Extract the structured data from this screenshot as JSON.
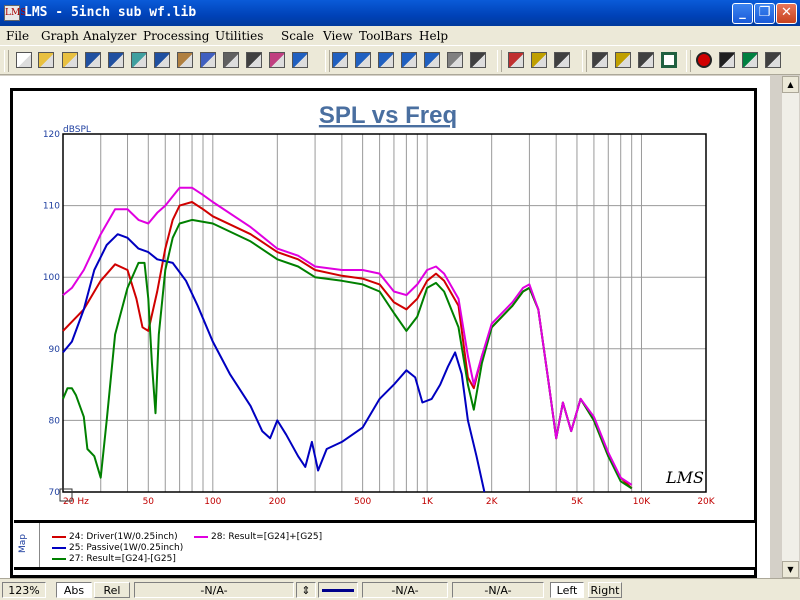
{
  "window": {
    "title": "LMS - 5inch sub wf.lib",
    "app_icon_text": "LMS"
  },
  "menu": [
    "File",
    "Graph",
    "Analyzer",
    "Processing",
    "Utilities",
    "Scale",
    "View",
    "ToolBars",
    "Help"
  ],
  "toolbar_icons": [
    "new-icon",
    "open-icon",
    "open-folder-icon",
    "save-icon",
    "save-as-icon",
    "import-icon",
    "export-icon",
    "library-icon",
    "print-preview-icon",
    "print-icon",
    "notes-icon",
    "curve-library-icon",
    "zoom-in-icon",
    "zoom-out-icon",
    "zoom-1-icon",
    "zoom-2-icon",
    "zoom-4-icon",
    "zoom-8-icon",
    "grid-icon",
    "table-icon",
    "graph-icon",
    "hardware-icon",
    "target-icon",
    "markers-icon",
    "compare-icon",
    "overlay-icon",
    "stop-icon",
    "record-icon",
    "run-icon",
    "connect-icon",
    "probe-icon"
  ],
  "chart_data": {
    "type": "line",
    "title": "SPL vs Freq",
    "ylabel": "dBSPL",
    "xscale": "log",
    "xlim": [
      20,
      20000
    ],
    "ylim": [
      70,
      120
    ],
    "grid": true,
    "xticks": [
      {
        "v": 20,
        "label": "20 Hz"
      },
      {
        "v": 50,
        "label": "50"
      },
      {
        "v": 100,
        "label": "100"
      },
      {
        "v": 200,
        "label": "200"
      },
      {
        "v": 500,
        "label": "500"
      },
      {
        "v": 1000,
        "label": "1K"
      },
      {
        "v": 2000,
        "label": "2K"
      },
      {
        "v": 5000,
        "label": "5K"
      },
      {
        "v": 10000,
        "label": "10K"
      },
      {
        "v": 20000,
        "label": "20K"
      }
    ],
    "yticks": [
      {
        "v": 70,
        "label": "70"
      },
      {
        "v": 80,
        "label": "80"
      },
      {
        "v": 90,
        "label": "90"
      },
      {
        "v": 100,
        "label": "100"
      },
      {
        "v": 110,
        "label": "110"
      },
      {
        "v": 120,
        "label": "120"
      }
    ],
    "watermark": "LMS",
    "series": [
      {
        "name": "24: Driver(1W/0.25inch)",
        "color": "#d00000",
        "points": [
          [
            20,
            92.5
          ],
          [
            25,
            95.5
          ],
          [
            30,
            99.5
          ],
          [
            35,
            101.8
          ],
          [
            40,
            101
          ],
          [
            44,
            97
          ],
          [
            47,
            93
          ],
          [
            50,
            92.5
          ],
          [
            55,
            98
          ],
          [
            60,
            104
          ],
          [
            65,
            108
          ],
          [
            70,
            110
          ],
          [
            80,
            110.5
          ],
          [
            90,
            109.5
          ],
          [
            100,
            108.5
          ],
          [
            150,
            106
          ],
          [
            200,
            103.5
          ],
          [
            250,
            102.5
          ],
          [
            300,
            101
          ],
          [
            400,
            100.2
          ],
          [
            500,
            99.8
          ],
          [
            600,
            99
          ],
          [
            700,
            96.5
          ],
          [
            800,
            95.5
          ],
          [
            900,
            97
          ],
          [
            1000,
            99.5
          ],
          [
            1100,
            100.5
          ],
          [
            1200,
            99.5
          ],
          [
            1400,
            96
          ],
          [
            1550,
            86
          ],
          [
            1650,
            84.5
          ],
          [
            1800,
            89
          ],
          [
            2000,
            93
          ],
          [
            2500,
            96
          ],
          [
            2800,
            98
          ],
          [
            3000,
            98.5
          ],
          [
            3300,
            95.5
          ],
          [
            3700,
            85
          ],
          [
            4000,
            77.5
          ],
          [
            4300,
            82.5
          ],
          [
            4700,
            78.5
          ],
          [
            5200,
            83
          ],
          [
            6000,
            80
          ],
          [
            7000,
            75
          ],
          [
            8000,
            72
          ],
          [
            9000,
            70.5
          ]
        ]
      },
      {
        "name": "25: Passive(1W/0.25inch)",
        "color": "#0000c0",
        "points": [
          [
            20,
            89.5
          ],
          [
            22,
            91
          ],
          [
            25,
            95.5
          ],
          [
            28,
            101
          ],
          [
            32,
            104.5
          ],
          [
            36,
            106
          ],
          [
            40,
            105.5
          ],
          [
            45,
            104
          ],
          [
            50,
            103.5
          ],
          [
            55,
            102.5
          ],
          [
            65,
            102
          ],
          [
            75,
            99.5
          ],
          [
            85,
            96
          ],
          [
            100,
            91
          ],
          [
            120,
            86.5
          ],
          [
            150,
            82
          ],
          [
            170,
            78.5
          ],
          [
            185,
            77.5
          ],
          [
            200,
            80
          ],
          [
            220,
            78
          ],
          [
            250,
            75
          ],
          [
            270,
            73.5
          ],
          [
            290,
            77
          ],
          [
            310,
            73
          ],
          [
            340,
            76
          ],
          [
            400,
            77
          ],
          [
            500,
            79
          ],
          [
            600,
            83
          ],
          [
            700,
            85
          ],
          [
            800,
            87
          ],
          [
            880,
            86
          ],
          [
            950,
            82.5
          ],
          [
            1050,
            83
          ],
          [
            1150,
            85
          ],
          [
            1250,
            87.5
          ],
          [
            1350,
            89.5
          ],
          [
            1450,
            86.5
          ],
          [
            1550,
            80
          ],
          [
            1700,
            75
          ],
          [
            1850,
            70
          ]
        ]
      },
      {
        "name": "27: Result=[G24]-[G25]",
        "color": "#008000",
        "points": [
          [
            20,
            83
          ],
          [
            21,
            84.5
          ],
          [
            22,
            84.5
          ],
          [
            23,
            83.5
          ],
          [
            25,
            80.5
          ],
          [
            26,
            76
          ],
          [
            28,
            75
          ],
          [
            30,
            72
          ],
          [
            32,
            80
          ],
          [
            35,
            92
          ],
          [
            40,
            98.5
          ],
          [
            45,
            102
          ],
          [
            48,
            102
          ],
          [
            50,
            97
          ],
          [
            52,
            88
          ],
          [
            54,
            81
          ],
          [
            56,
            92
          ],
          [
            60,
            101
          ],
          [
            65,
            105.5
          ],
          [
            70,
            107.5
          ],
          [
            80,
            108
          ],
          [
            100,
            107.5
          ],
          [
            150,
            105
          ],
          [
            200,
            102.5
          ],
          [
            250,
            101.5
          ],
          [
            300,
            100
          ],
          [
            400,
            99.5
          ],
          [
            500,
            99
          ],
          [
            600,
            98
          ],
          [
            700,
            95
          ],
          [
            800,
            92.5
          ],
          [
            900,
            94.5
          ],
          [
            1000,
            98.5
          ],
          [
            1100,
            99.2
          ],
          [
            1200,
            98
          ],
          [
            1400,
            93
          ],
          [
            1550,
            85
          ],
          [
            1650,
            81.5
          ],
          [
            1800,
            88
          ],
          [
            2000,
            93
          ],
          [
            2500,
            96
          ],
          [
            2800,
            98
          ],
          [
            3000,
            98.5
          ],
          [
            3300,
            95.5
          ],
          [
            3700,
            85
          ],
          [
            4000,
            77.5
          ],
          [
            4300,
            82.5
          ],
          [
            4700,
            78.5
          ],
          [
            5200,
            83
          ],
          [
            6000,
            80
          ],
          [
            7000,
            75
          ],
          [
            8000,
            71.5
          ],
          [
            9000,
            70.5
          ]
        ]
      },
      {
        "name": "28: Result=[G24]+[G25]",
        "color": "#e000e0",
        "points": [
          [
            20,
            97.5
          ],
          [
            22,
            98.5
          ],
          [
            25,
            101
          ],
          [
            30,
            106
          ],
          [
            35,
            109.5
          ],
          [
            40,
            109.5
          ],
          [
            45,
            108
          ],
          [
            50,
            107.5
          ],
          [
            55,
            109
          ],
          [
            60,
            110
          ],
          [
            70,
            112.5
          ],
          [
            80,
            112.5
          ],
          [
            90,
            111.5
          ],
          [
            100,
            110.5
          ],
          [
            150,
            107
          ],
          [
            200,
            104
          ],
          [
            250,
            103
          ],
          [
            300,
            101.5
          ],
          [
            400,
            101
          ],
          [
            500,
            101
          ],
          [
            600,
            100.5
          ],
          [
            700,
            98
          ],
          [
            800,
            97.5
          ],
          [
            900,
            99
          ],
          [
            1000,
            101
          ],
          [
            1100,
            101.5
          ],
          [
            1200,
            100.5
          ],
          [
            1400,
            97
          ],
          [
            1550,
            89
          ],
          [
            1650,
            85
          ],
          [
            1800,
            89
          ],
          [
            2000,
            93.5
          ],
          [
            2500,
            96.5
          ],
          [
            2800,
            98.5
          ],
          [
            3000,
            99
          ],
          [
            3300,
            95.5
          ],
          [
            3700,
            85
          ],
          [
            4000,
            77.5
          ],
          [
            4300,
            82.5
          ],
          [
            4700,
            78.5
          ],
          [
            5200,
            83
          ],
          [
            6000,
            80.5
          ],
          [
            7000,
            75.5
          ],
          [
            8000,
            72
          ],
          [
            9000,
            71
          ]
        ]
      }
    ]
  },
  "legend": {
    "side_label": "Map"
  },
  "status": {
    "zoom": "123%",
    "abs": "Abs",
    "rel": "Rel",
    "na1": "-N/A-",
    "na2": "-N/A-",
    "na3": "-N/A-",
    "left": "Left",
    "right": "Right"
  },
  "colors": {
    "title_text": "#4a6fa0",
    "axis_text": "#2040a0",
    "tick_text": "#c00000"
  }
}
